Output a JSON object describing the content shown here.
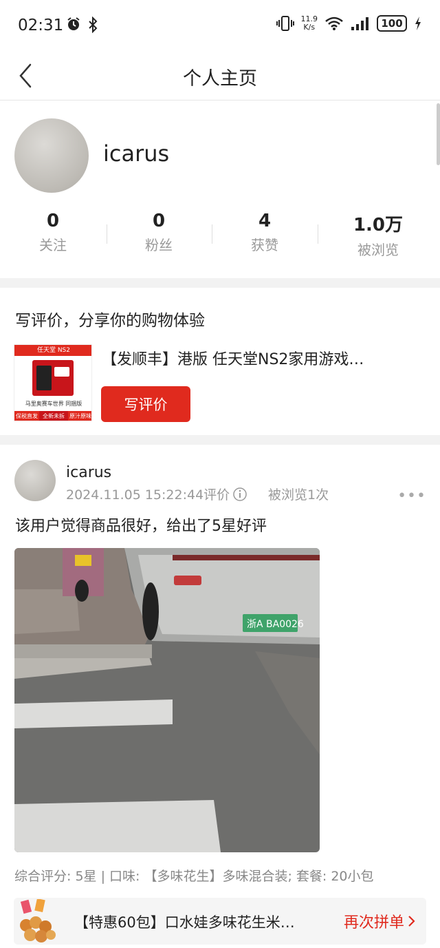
{
  "status": {
    "time": "02:31",
    "netspeed_value": "11.9",
    "netspeed_unit": "K/s",
    "battery": "100"
  },
  "nav": {
    "title": "个人主页"
  },
  "profile": {
    "username": "icarus",
    "stats": [
      {
        "value": "0",
        "label": "关注"
      },
      {
        "value": "0",
        "label": "粉丝"
      },
      {
        "value": "4",
        "label": "获赞"
      },
      {
        "value": "1.0万",
        "label": "被浏览"
      }
    ]
  },
  "write_review": {
    "title": "写评价，分享你的购物体验",
    "product_name": "【发顺丰】港版 任天堂NS2家用游戏…",
    "button_label": "写评价",
    "thumb": {
      "badge": "任天堂 NS2",
      "caption": "马里奥赛车世界 同捆版",
      "tag_left": "保税直发",
      "tag_mid": "全新未拆封",
      "tag_right": "原汁原味"
    }
  },
  "post": {
    "user": "icarus",
    "timestamp": "2024.11.05 15:22:44评价",
    "views": "被浏览1次",
    "more": "•••",
    "text": "该用户觉得商品很好，给出了5星好评",
    "plate": "浙A BA0026",
    "tags": "综合评分: 5星 | 口味: 【多味花生】多味混合装; 套餐: 20小包",
    "linked_product": {
      "name": "【特惠60包】口水娃多味花生米…",
      "action": "再次拼单"
    }
  },
  "colors": {
    "accent": "#e02a1e",
    "muted": "#999999"
  }
}
